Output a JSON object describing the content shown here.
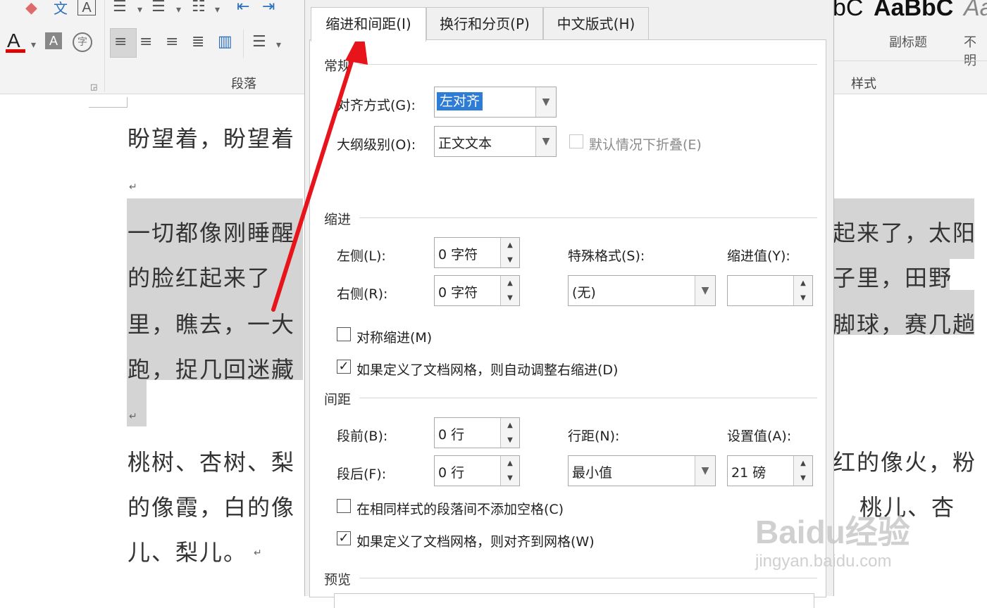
{
  "ribbon": {
    "paragraph_group_label": "段落",
    "styles_group_label": "样式",
    "style_samples": [
      {
        "sample": "bC",
        "name": ""
      },
      {
        "sample": "AaBbC",
        "name": "副标题"
      },
      {
        "sample": "Aa",
        "name": "不明"
      }
    ],
    "font_color_letter": "A",
    "boxed_letter": "A",
    "enclosed_char": "字",
    "top_text_char": "文",
    "top_boxed_letter": "A"
  },
  "document": {
    "line1": "盼望着，盼望着",
    "para1_left": [
      "一切都像刚睡醒",
      "的脸红起来了",
      "里，瞧去，一大",
      "跑，捉几回迷藏"
    ],
    "para1_right": [
      "起来了，太阳",
      "子里，田野",
      "脚球，赛几趟"
    ],
    "para2_left": [
      "桃树、杏树、梨",
      "的像霞，白的像",
      "儿、梨儿。"
    ],
    "para2_right": [
      "红的像火，粉",
      "桃儿、杏"
    ],
    "para_mark": "↵"
  },
  "dialog": {
    "tabs": [
      {
        "label": "缩进和间距(I)",
        "active": true
      },
      {
        "label": "换行和分页(P)",
        "active": false
      },
      {
        "label": "中文版式(H)",
        "active": false
      }
    ],
    "general": {
      "title": "常规",
      "alignment_label": "对齐方式(G):",
      "alignment_value": "左对齐",
      "outline_label": "大纲级别(O):",
      "outline_value": "正文文本",
      "collapse_label": "默认情况下折叠(E)",
      "collapse_checked": false
    },
    "indent": {
      "title": "缩进",
      "left_label": "左侧(L):",
      "left_value": "0 字符",
      "right_label": "右侧(R):",
      "right_value": "0 字符",
      "special_label": "特殊格式(S):",
      "special_value": "(无)",
      "by_label": "缩进值(Y):",
      "by_value": "",
      "mirror_label": "对称缩进(M)",
      "mirror_checked": false,
      "auto_adjust_label": "如果定义了文档网格，则自动调整右缩进(D)",
      "auto_adjust_checked": true
    },
    "spacing": {
      "title": "间距",
      "before_label": "段前(B):",
      "before_value": "0 行",
      "after_label": "段后(F):",
      "after_value": "0 行",
      "line_spacing_label": "行距(N):",
      "line_spacing_value": "最小值",
      "at_label": "设置值(A):",
      "at_value": "21 磅",
      "no_space_label": "在相同样式的段落间不添加空格(C)",
      "no_space_checked": false,
      "snap_grid_label": "如果定义了文档网格，则对齐到网格(W)",
      "snap_grid_checked": true
    },
    "preview": {
      "title": "预览"
    }
  },
  "annotation": {
    "arrow_color": "#e8141c"
  },
  "watermark": {
    "brand": "Baidu经验",
    "url": "jingyan.baidu.com"
  },
  "colors": {
    "selection": "#2d7cd6",
    "highlight": "#d4d4d4",
    "ribbon_bg": "#f3f3f3"
  }
}
